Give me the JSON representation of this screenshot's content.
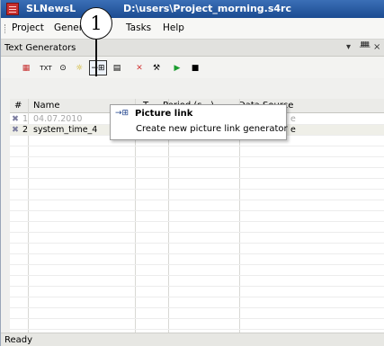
{
  "window": {
    "title_prefix": "SLNewsL",
    "title_suffix": "D:\\users\\Project_morning.s4rc"
  },
  "callout": {
    "number": "1"
  },
  "menubar": {
    "items": [
      "Project",
      "Generators",
      "Tasks",
      "Help"
    ]
  },
  "panel": {
    "title": "Text Generators",
    "controls": {
      "dropdown": "▾",
      "pin": "ᚙ",
      "close": "×"
    }
  },
  "toolbar": {
    "buttons": [
      {
        "name": "table-generator-icon",
        "glyph": "▦"
      },
      {
        "name": "text-generator-icon",
        "glyph": "TXT"
      },
      {
        "name": "clock-generator-icon",
        "glyph": "⊙"
      },
      {
        "name": "sun-generator-icon",
        "glyph": "☼"
      },
      {
        "name": "picture-link-generator-icon",
        "glyph": "→⊞"
      },
      {
        "name": "properties-icon",
        "glyph": "▤"
      },
      {
        "name": "delete-icon",
        "glyph": "✕"
      },
      {
        "name": "tools-icon",
        "glyph": "⚒"
      },
      {
        "name": "play-icon",
        "glyph": "▶"
      },
      {
        "name": "stop-icon",
        "glyph": "■"
      }
    ]
  },
  "table": {
    "columns": [
      "#",
      "Name",
      "T",
      "Period (s...)",
      "Data Source"
    ],
    "rows": [
      {
        "num": "1",
        "name": "04.07.2010",
        "source": "e",
        "dim": true
      },
      {
        "num": "2",
        "name": "system_time_4",
        "source": "e",
        "dim": false
      }
    ]
  },
  "popup": {
    "icon": "→⊞",
    "title": "Picture link",
    "description": "Create new picture link generator"
  },
  "status": {
    "text": "Ready"
  },
  "colors": {
    "titlebar": "#1b4b91",
    "accent_red": "#c62f2f",
    "play_green": "#1a9c2e",
    "delete_red": "#d23a3a"
  }
}
